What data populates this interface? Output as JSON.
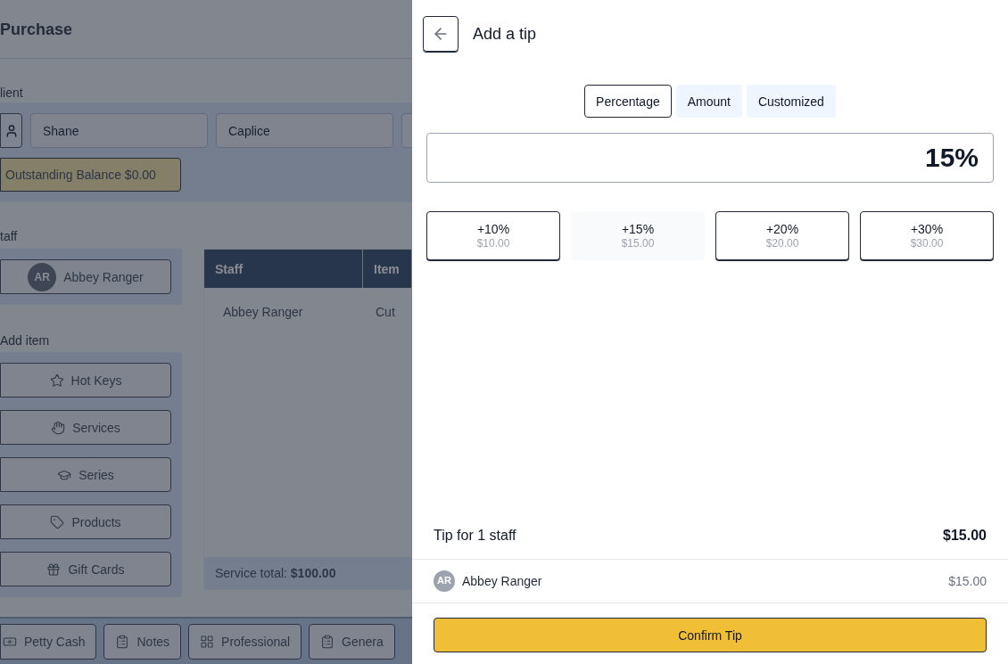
{
  "page": {
    "title": "Purchase",
    "client": {
      "label": "lient",
      "fields": [
        {
          "value": "Shane"
        },
        {
          "value": "Caplice"
        }
      ],
      "balance_button": "Outstanding Balance $0.00"
    },
    "staff": {
      "label": "taff",
      "staff_button": {
        "initials": "AR",
        "name": "Abbey Ranger"
      }
    },
    "add_item": {
      "label": "Add item",
      "buttons": [
        {
          "kind": "star",
          "label": "Hot Keys"
        },
        {
          "kind": "hand",
          "label": "Services"
        },
        {
          "kind": "cap",
          "label": "Series"
        },
        {
          "kind": "tag",
          "label": "Products"
        },
        {
          "kind": "gift",
          "label": "Gift Cards"
        }
      ]
    },
    "table": {
      "columns": [
        "Staff",
        "Item"
      ],
      "rows": [
        [
          "Abbey Ranger",
          "Cut"
        ]
      ],
      "footer": "Service total: **$100.00**"
    },
    "bottom_bar": [
      {
        "kind": "cash",
        "label": "Petty Cash"
      },
      {
        "kind": "clipboard",
        "label": "Notes"
      },
      {
        "kind": "grid",
        "label": "Professional"
      },
      {
        "kind": "clipboard",
        "label": "Genera"
      }
    ]
  },
  "drawer": {
    "title": "Add a tip",
    "tabs": [
      {
        "label": "Percentage",
        "selected": true
      },
      {
        "label": "Amount",
        "selected": false
      },
      {
        "label": "Customized",
        "selected": false
      }
    ],
    "value": "15%",
    "presets": [
      {
        "label": "+10%",
        "amount": "$10.00",
        "selected": false
      },
      {
        "label": "+15%",
        "amount": "$15.00",
        "selected": true
      },
      {
        "label": "+20%",
        "amount": "$20.00",
        "selected": false
      },
      {
        "label": "+30%",
        "amount": "$30.00",
        "selected": false
      }
    ],
    "summary": {
      "label": "Tip for 1 staff",
      "total": "$15.00"
    },
    "staff_rows": [
      {
        "initials": "AR",
        "name": "Abbey Ranger",
        "amount": "$15.00"
      }
    ],
    "confirm": "Confirm Tip"
  }
}
